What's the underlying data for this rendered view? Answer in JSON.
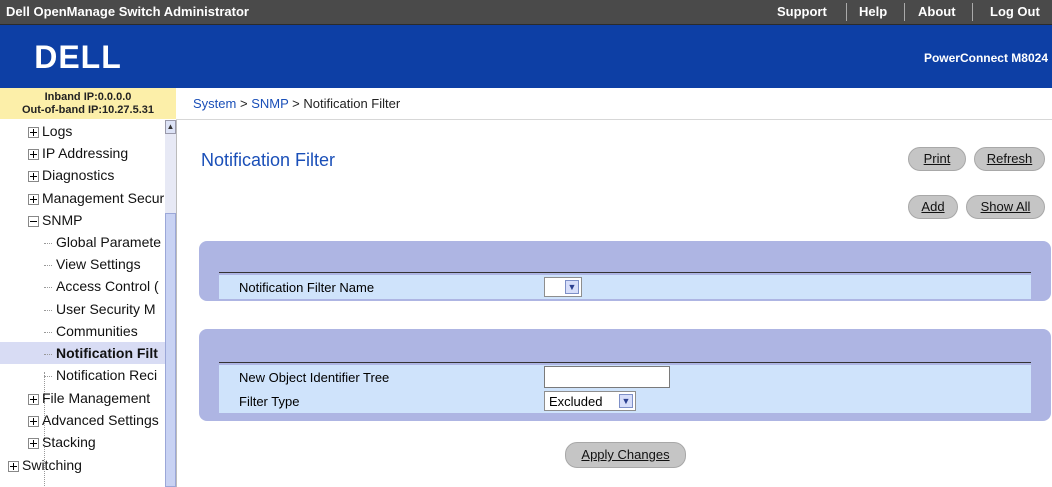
{
  "topbar": {
    "title": "Dell OpenManage Switch Administrator",
    "links": [
      "Support",
      "Help",
      "About",
      "Log Out"
    ]
  },
  "brand": {
    "logo": "DELL",
    "product": "PowerConnect M8024"
  },
  "ip_info": {
    "inband": "Inband IP:0.0.0.0",
    "outband": "Out-of-band IP:10.27.5.31"
  },
  "breadcrumb": {
    "system": "System",
    "snmp": "SNMP",
    "sep": ">",
    "current": "Notification Filter"
  },
  "tree": {
    "items": [
      {
        "label": "Logs",
        "expander": "plus"
      },
      {
        "label": "IP Addressing",
        "expander": "plus"
      },
      {
        "label": "Diagnostics",
        "expander": "plus"
      },
      {
        "label": "Management Secur",
        "expander": "plus"
      },
      {
        "label": "SNMP",
        "expander": "minus"
      },
      {
        "label": "Global Paramete"
      },
      {
        "label": "View Settings"
      },
      {
        "label": "Access Control ("
      },
      {
        "label": "User Security M"
      },
      {
        "label": "Communities"
      },
      {
        "label": "Notification Filt",
        "selected": true
      },
      {
        "label": "Notification Reci"
      },
      {
        "label": "File Management",
        "expander": "plus"
      },
      {
        "label": "Advanced Settings",
        "expander": "plus"
      },
      {
        "label": "Stacking",
        "expander": "plus"
      },
      {
        "label": "Switching",
        "expander": "plus"
      }
    ]
  },
  "main": {
    "title": "Notification Filter",
    "buttons": {
      "print": "Print",
      "refresh": "Refresh",
      "add": "Add",
      "show_all": "Show All",
      "apply": "Apply Changes"
    },
    "filter_name_label": "Notification Filter Name",
    "filter_name_value": "",
    "oid_label": "New Object Identifier Tree",
    "oid_value": "",
    "filter_type_label": "Filter Type",
    "filter_type_value": "Excluded"
  },
  "colors": {
    "topbar": "#4a4a4a",
    "brand": "#0d3fa5",
    "ip_panel": "#fcefa9",
    "panel": "#aeb5e3",
    "field_row": "#cfe3fb",
    "title": "#1a4fb8",
    "selected_row": "#d8dcf4"
  }
}
